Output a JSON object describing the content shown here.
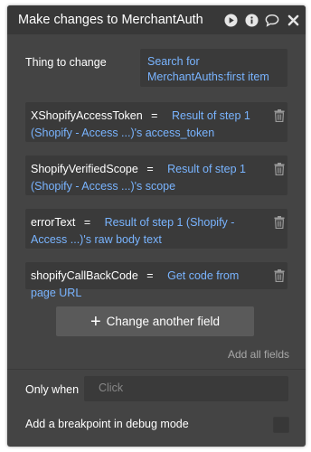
{
  "window": {
    "title": "Make changes to MerchantAuth"
  },
  "toolbar_icons": [
    "play-icon",
    "info-icon",
    "comment-icon",
    "close-icon"
  ],
  "thing_to_change": {
    "label": "Thing to change",
    "value": "Search for MerchantAuths:first item"
  },
  "fields": [
    {
      "key": "XShopifyAccessToken",
      "eq": "=",
      "value": "Result of step 1 (Shopify - Access ...)'s access_token"
    },
    {
      "key": "ShopifyVerifiedScope",
      "eq": "=",
      "value": "Result of step 1 (Shopify - Access ...)'s scope"
    },
    {
      "key": "errorText",
      "eq": "=",
      "value": "Result of step 1 (Shopify - Access ...)'s raw body text"
    },
    {
      "key": "shopifyCallBackCode",
      "eq": "=",
      "value": "Get code from page URL"
    }
  ],
  "actions": {
    "change_another_field": "Change another field",
    "add_all_fields": "Add all fields"
  },
  "conditions": {
    "only_when_label": "Only when",
    "only_when_placeholder": "Click"
  },
  "breakpoint": {
    "label": "Add a breakpoint in debug mode",
    "checked": false
  },
  "colors": {
    "panel_bg": "#444444",
    "titlebar_bg": "#383838",
    "input_bg": "#3a3a3a",
    "dynamic_text": "#79b4ff",
    "button_bg": "#5a5a5a",
    "muted_text": "#a8a8a8"
  }
}
